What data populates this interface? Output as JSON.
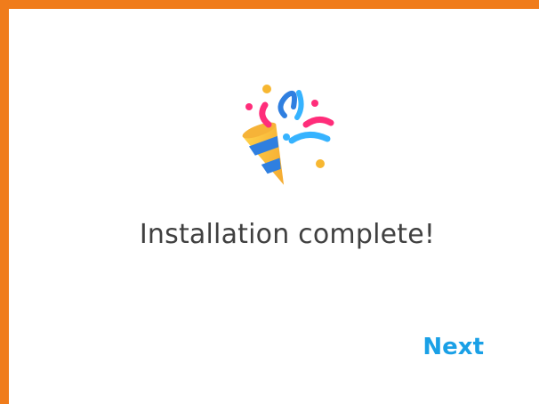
{
  "dialog": {
    "title": "Installation complete!",
    "next_label": "Next"
  },
  "icons": {
    "celebration": "party-popper-icon"
  },
  "colors": {
    "border": "#f07c1b",
    "accent": "#1aa0e6",
    "text": "#404040"
  }
}
